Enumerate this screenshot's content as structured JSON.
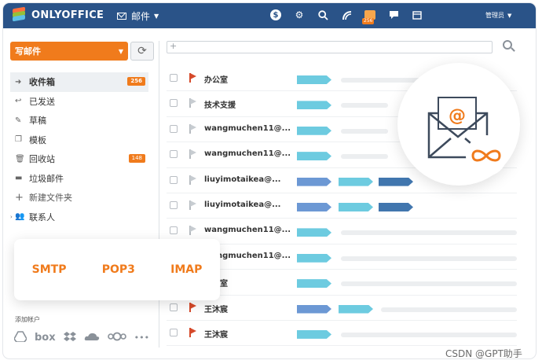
{
  "app": {
    "brand": "ONLYOFFICE",
    "module": "邮件",
    "user": "管理员"
  },
  "colors": {
    "topbar": "#2a5388",
    "accent": "#f07b1c",
    "flag_red": "#d64a2b",
    "tag_light": "#6dcbe0",
    "tag_mid": "#6c98d4",
    "tag_dark": "#4176ae"
  },
  "header": {
    "inbox_badge": "256"
  },
  "toolbar": {
    "compose_label": "写邮件",
    "search_placeholder": ""
  },
  "sidebar": {
    "folders": [
      {
        "label": "收件箱",
        "count": "256",
        "icon": "inbox-arrow-icon"
      },
      {
        "label": "已发送",
        "count": "",
        "icon": "reply-icon"
      },
      {
        "label": "草稿",
        "count": "",
        "icon": "draft-edit-icon"
      },
      {
        "label": "模板",
        "count": "",
        "icon": "template-icon"
      },
      {
        "label": "回收站",
        "count": "148",
        "icon": "trash-icon"
      },
      {
        "label": "垃圾邮件",
        "count": "",
        "icon": "folder-icon"
      }
    ],
    "new_folder": "新建文件夹",
    "contacts": "联系人",
    "add_account": "添加帐户",
    "cloud_services": [
      "google-drive-icon",
      "box-icon",
      "dropbox-icon",
      "onedrive-icon",
      "nextcloud-icon",
      "more-icon"
    ],
    "cloud_box_text": "box"
  },
  "protocols": [
    "SMTP",
    "POP3",
    "IMAP"
  ],
  "messages": [
    {
      "sender": "办公室",
      "flagged": true
    },
    {
      "sender": "技术支援",
      "flagged": false
    },
    {
      "sender": "wangmuchen11@...",
      "flagged": false
    },
    {
      "sender": "wangmuchen11@...",
      "flagged": false
    },
    {
      "sender": "liuyimotaikea@...",
      "flagged": false
    },
    {
      "sender": "liuyimotaikea@...",
      "flagged": false
    },
    {
      "sender": "wangmuchen11@...",
      "flagged": false
    },
    {
      "sender": "wangmuchen11@...",
      "flagged": false
    },
    {
      "sender": "办公室",
      "flagged": false
    },
    {
      "sender": "王沐宸",
      "flagged": true
    },
    {
      "sender": "王沐宸",
      "flagged": true
    }
  ],
  "watermark": "CSDN @GPT助手"
}
